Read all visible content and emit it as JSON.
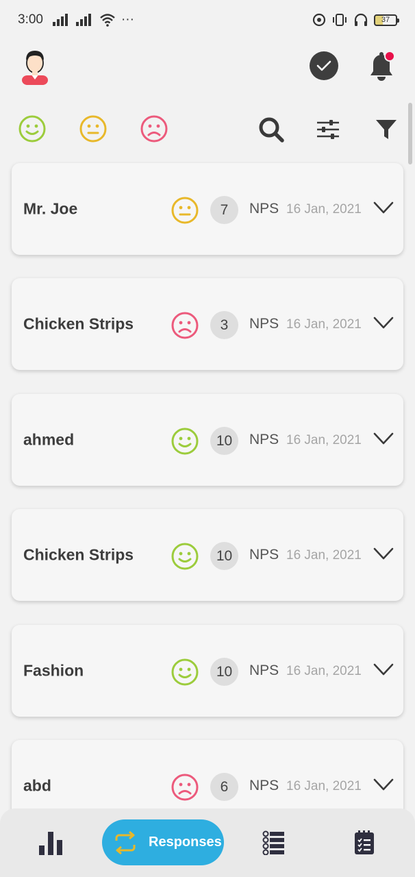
{
  "status_bar": {
    "time": "3:00",
    "more": "···",
    "battery": "37"
  },
  "colors": {
    "happy": "#9ccc3c",
    "neutral": "#e8b82a",
    "sad": "#ec5a7c",
    "accent": "#2eaee0",
    "dark_icon": "#3e3e3e"
  },
  "header": {
    "avatar_icon": "user-avatar-icon",
    "check_icon": "check-circle-icon",
    "bell_icon": "bell-icon"
  },
  "filters": {
    "faces": [
      "happy-face-icon",
      "neutral-face-icon",
      "sad-face-icon"
    ],
    "tools": [
      "search-icon",
      "sliders-icon",
      "filter-icon"
    ]
  },
  "responses": [
    {
      "name": "Mr. Joe",
      "sentiment": "neutral",
      "score": "7",
      "type": "NPS",
      "date": "16 Jan, 2021"
    },
    {
      "name": "Chicken Strips",
      "sentiment": "sad",
      "score": "3",
      "type": "NPS",
      "date": "16 Jan, 2021"
    },
    {
      "name": "ahmed",
      "sentiment": "happy",
      "score": "10",
      "type": "NPS",
      "date": "16 Jan, 2021"
    },
    {
      "name": "Chicken Strips",
      "sentiment": "happy",
      "score": "10",
      "type": "NPS",
      "date": "16 Jan, 2021"
    },
    {
      "name": "Fashion",
      "sentiment": "happy",
      "score": "10",
      "type": "NPS",
      "date": "16 Jan, 2021"
    },
    {
      "name": "abd",
      "sentiment": "sad",
      "score": "6",
      "type": "NPS",
      "date": "16 Jan, 2021"
    }
  ],
  "bottom_nav": {
    "items": [
      "bar-chart-icon",
      "refresh-icon",
      "list-icon",
      "clipboard-icon"
    ],
    "active_label": "Responses"
  }
}
